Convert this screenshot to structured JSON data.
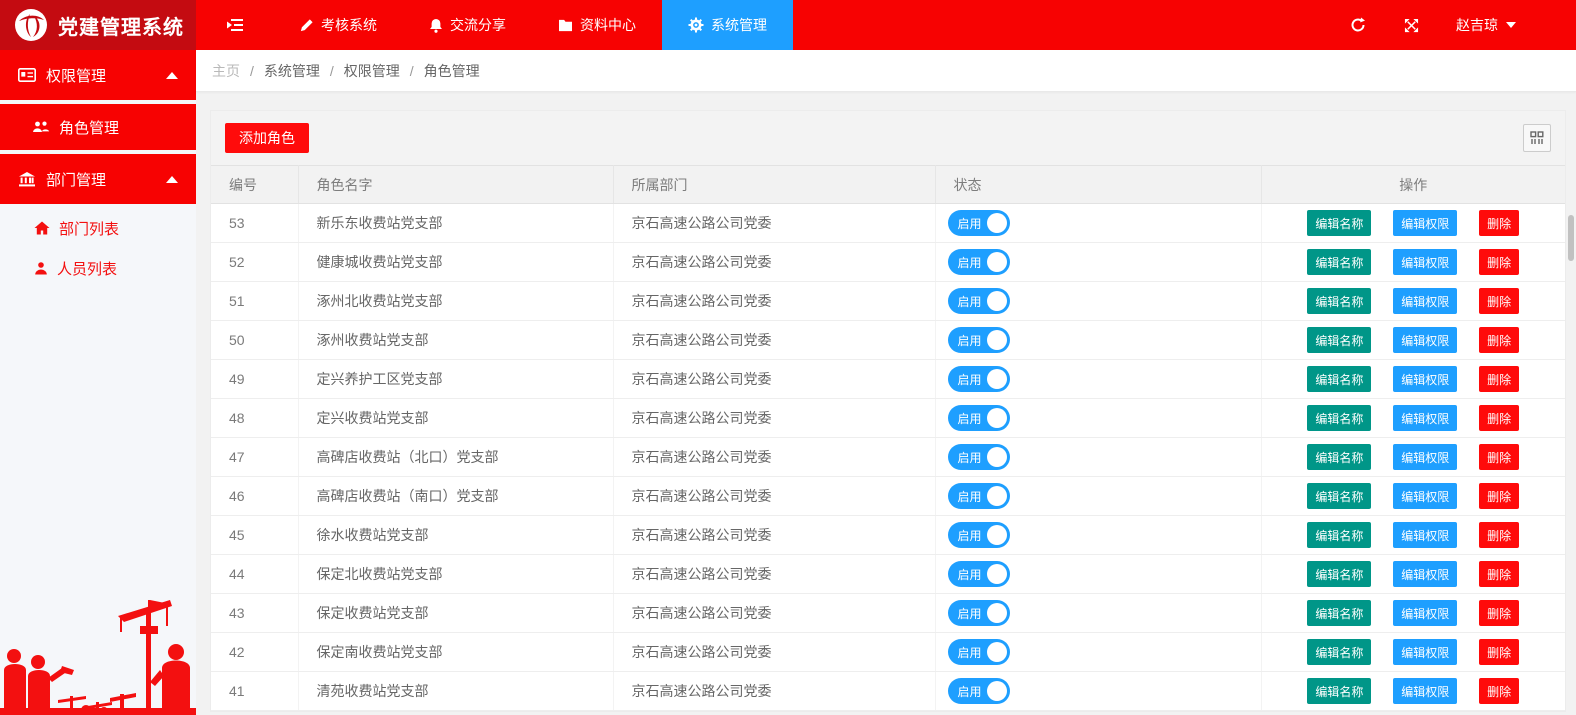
{
  "app": {
    "title": "党建管理系统"
  },
  "topnav": {
    "items": [
      {
        "label": "考核系统",
        "icon": "pencil-icon",
        "active": false
      },
      {
        "label": "交流分享",
        "icon": "bell-icon",
        "active": false
      },
      {
        "label": "资料中心",
        "icon": "folder-icon",
        "active": false
      },
      {
        "label": "系统管理",
        "icon": "gears-icon",
        "active": true
      }
    ],
    "username": "赵吉琼"
  },
  "sidebar": {
    "groups": [
      {
        "label": "权限管理",
        "icon": "id-card-icon",
        "expanded": true
      },
      {
        "label": "部门管理",
        "icon": "bank-icon",
        "expanded": true
      }
    ],
    "active_item": {
      "label": "角色管理",
      "icon": "users-icon"
    },
    "sub_items": [
      {
        "label": "部门列表",
        "icon": "home-icon"
      },
      {
        "label": "人员列表",
        "icon": "user-icon"
      }
    ]
  },
  "breadcrumb": {
    "separator": "/",
    "items": [
      "主页",
      "系统管理",
      "权限管理",
      "角色管理"
    ]
  },
  "toolbar": {
    "add_button": "添加角色"
  },
  "table": {
    "headers": [
      "编号",
      "角色名字",
      "所属部门",
      "状态",
      "操作"
    ],
    "actions": [
      "编辑名称",
      "编辑权限",
      "删除"
    ],
    "rows": [
      {
        "id": "53",
        "name": "新乐东收费站党支部",
        "dept": "京石高速公路公司党委",
        "status": "启用",
        "enabled": true
      },
      {
        "id": "52",
        "name": "健康城收费站党支部",
        "dept": "京石高速公路公司党委",
        "status": "启用",
        "enabled": true
      },
      {
        "id": "51",
        "name": "涿州北收费站党支部",
        "dept": "京石高速公路公司党委",
        "status": "启用",
        "enabled": true
      },
      {
        "id": "50",
        "name": "涿州收费站党支部",
        "dept": "京石高速公路公司党委",
        "status": "启用",
        "enabled": true
      },
      {
        "id": "49",
        "name": "定兴养护工区党支部",
        "dept": "京石高速公路公司党委",
        "status": "启用",
        "enabled": true
      },
      {
        "id": "48",
        "name": "定兴收费站党支部",
        "dept": "京石高速公路公司党委",
        "status": "启用",
        "enabled": true
      },
      {
        "id": "47",
        "name": "高碑店收费站（北口）党支部",
        "dept": "京石高速公路公司党委",
        "status": "启用",
        "enabled": true
      },
      {
        "id": "46",
        "name": "高碑店收费站（南口）党支部",
        "dept": "京石高速公路公司党委",
        "status": "启用",
        "enabled": true
      },
      {
        "id": "45",
        "name": "徐水收费站党支部",
        "dept": "京石高速公路公司党委",
        "status": "启用",
        "enabled": true
      },
      {
        "id": "44",
        "name": "保定北收费站党支部",
        "dept": "京石高速公路公司党委",
        "status": "启用",
        "enabled": true
      },
      {
        "id": "43",
        "name": "保定收费站党支部",
        "dept": "京石高速公路公司党委",
        "status": "启用",
        "enabled": true
      },
      {
        "id": "42",
        "name": "保定南收费站党支部",
        "dept": "京石高速公路公司党委",
        "status": "启用",
        "enabled": true
      },
      {
        "id": "41",
        "name": "清苑收费站党支部",
        "dept": "京石高速公路公司党委",
        "status": "启用",
        "enabled": true
      }
    ]
  },
  "colors": {
    "header_red": "#f70202",
    "logo_red": "#c40b11",
    "active_blue": "#1E9FFF",
    "switch_blue": "#1E9FFF",
    "edit_name_teal": "#009688",
    "edit_perm_blue": "#1E9FFF",
    "delete_red": "#ff0b0b",
    "page_bg": "#f2f2f2"
  }
}
